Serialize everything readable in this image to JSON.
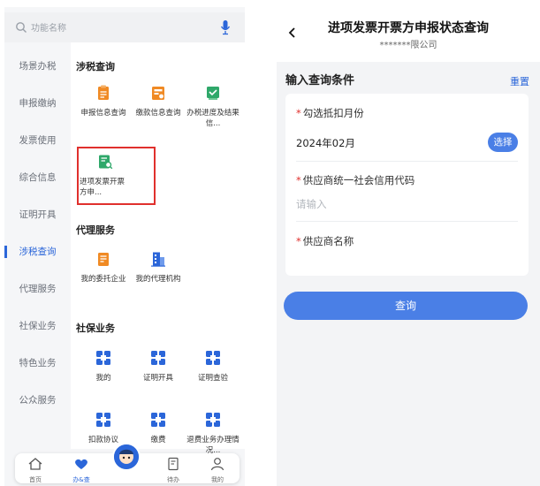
{
  "left": {
    "search_placeholder": "功能名称",
    "nav": [
      {
        "label": "场景办税",
        "active": false
      },
      {
        "label": "申报缴纳",
        "active": false
      },
      {
        "label": "发票使用",
        "active": false
      },
      {
        "label": "综合信息",
        "active": false
      },
      {
        "label": "证明开具",
        "active": false
      },
      {
        "label": "涉税查询",
        "active": true
      },
      {
        "label": "代理服务",
        "active": false
      },
      {
        "label": "社保业务",
        "active": false
      },
      {
        "label": "特色业务",
        "active": false
      },
      {
        "label": "公众服务",
        "active": false
      }
    ],
    "sections": {
      "tax_query": {
        "title": "涉税查询",
        "tiles": [
          {
            "label": "申报信息查询",
            "icon": "document-clock-icon"
          },
          {
            "label": "缴款信息查询",
            "icon": "payment-doc-icon"
          },
          {
            "label": "办税进度及结果信...",
            "icon": "progress-doc-icon"
          },
          {
            "label": "进项发票开票方申...",
            "icon": "invoice-search-icon"
          }
        ]
      },
      "agency": {
        "title": "代理服务",
        "tiles": [
          {
            "label": "我的委托企业",
            "icon": "entrust-doc-icon"
          },
          {
            "label": "我的代理机构",
            "icon": "building-icon"
          }
        ]
      },
      "social": {
        "title": "社保业务",
        "tiles": [
          {
            "label": "我的",
            "icon": "grid-icon"
          },
          {
            "label": "证明开具",
            "icon": "grid-icon"
          },
          {
            "label": "证明查验",
            "icon": "grid-icon"
          },
          {
            "label": "扣款协议",
            "icon": "grid-icon"
          },
          {
            "label": "缴费",
            "icon": "grid-icon"
          },
          {
            "label": "退费业务办理情况...",
            "icon": "grid-icon"
          }
        ]
      }
    },
    "dock": {
      "home": "首页",
      "office": "办&查",
      "todo": "待办",
      "mine": "我的"
    }
  },
  "right": {
    "title": "进项发票开票方申报状态查询",
    "subtitle": "*******限公司",
    "form_title": "输入查询条件",
    "reset": "重置",
    "fields": {
      "month_label": "勾选抵扣月份",
      "month_value": "2024年02月",
      "pick_button": "选择",
      "credit_label": "供应商统一社会信用代码",
      "credit_placeholder": "请输入",
      "name_label": "供应商名称"
    },
    "query_button": "查询"
  },
  "colors": {
    "accent": "#2b66d9",
    "button": "#4a7fe6",
    "highlight": "#e0302d",
    "icon_orange": "#f08a24",
    "icon_green": "#2fa86a"
  }
}
